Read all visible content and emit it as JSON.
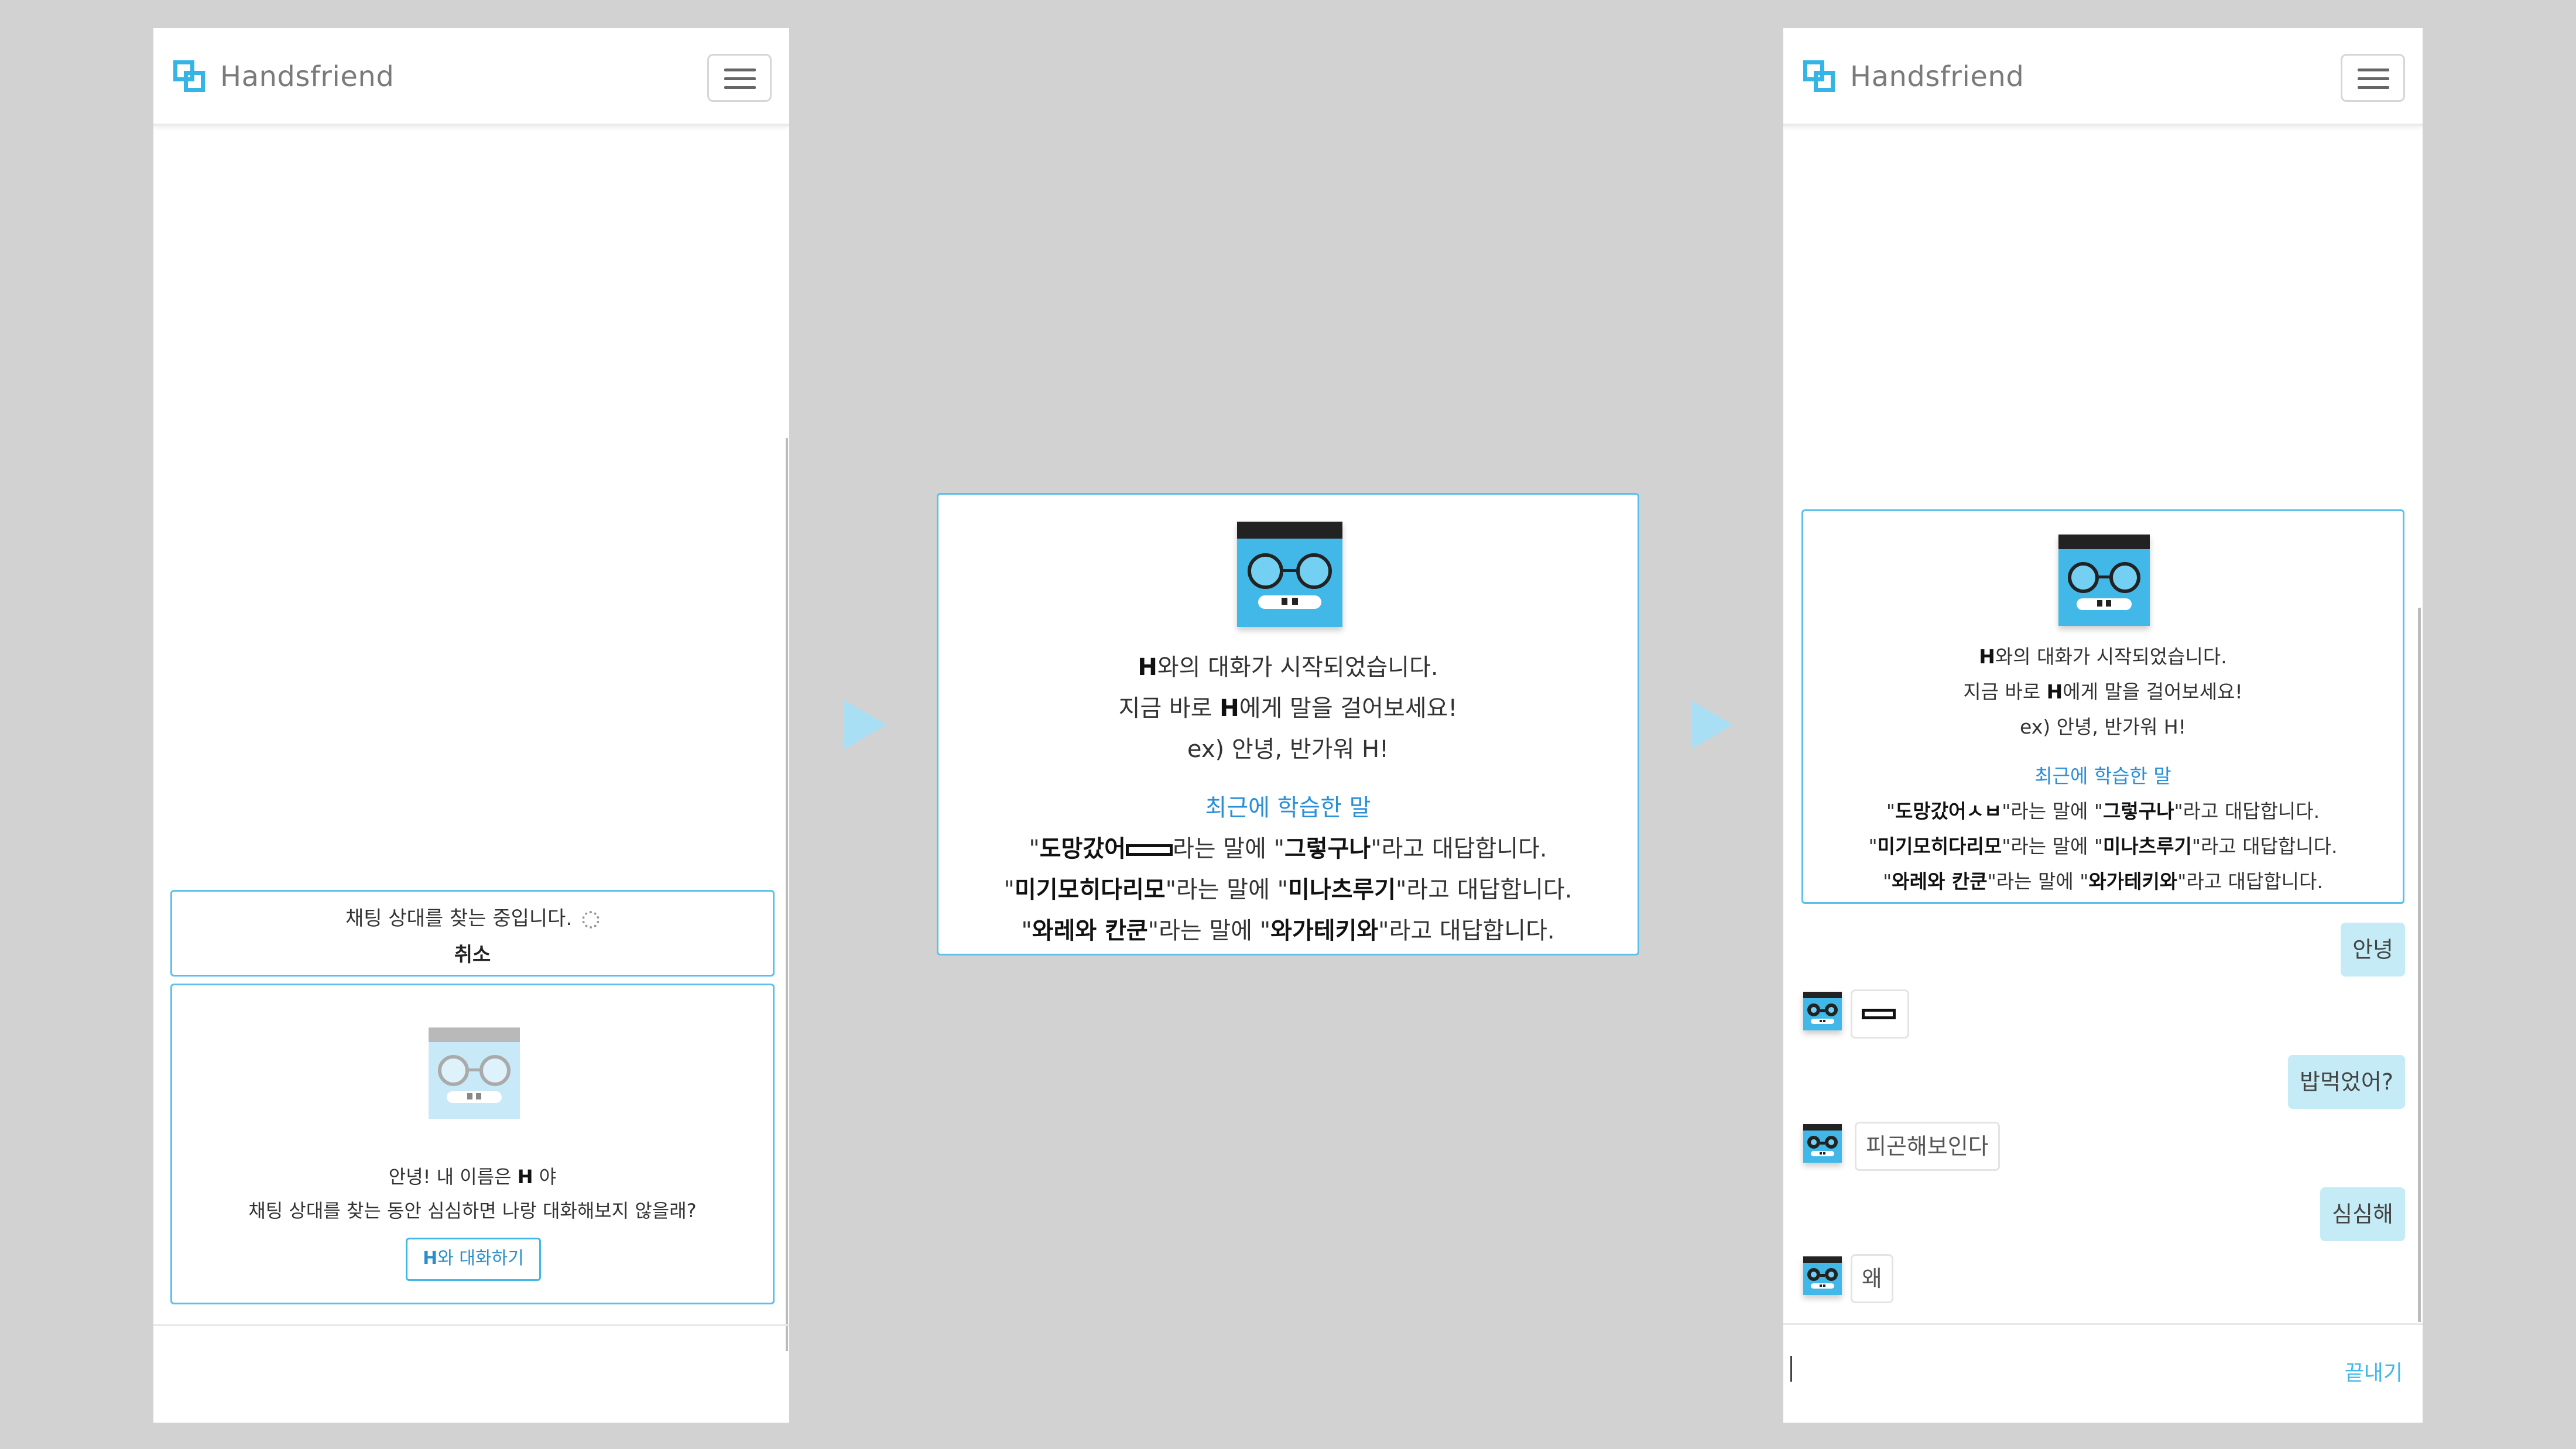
{
  "app": {
    "brand": "Handsfriend",
    "menu_icon": "hamburger-icon",
    "accent": "#35b5e5"
  },
  "panel1": {
    "searching": {
      "text": "채팅 상대를 찾는 중입니다.",
      "cancel": "취소"
    },
    "bot_invite": {
      "line1_pre": "안녕! 내 이름은 ",
      "line1_name": "H",
      "line1_post": " 야",
      "line2": "채팅 상대를 찾는 동안 심심하면 나랑 대화해보지 않을래?",
      "button_name": "H",
      "button_rest": "와 대화하기"
    }
  },
  "intro": {
    "start_name": "H",
    "start_rest": "와의 대화가 시작되었습니다.",
    "talk_pre": "지금 바로 ",
    "talk_name": "H",
    "talk_post": "에게 말을 걸어보세요!",
    "example": "ex) 안녕, 반가워 H!",
    "recent_title": "최근에 학습한 말",
    "learned_mid": "라는 말에 ",
    "learned_end": "라고 대답합니다.",
    "learned": [
      {
        "q": "도망갔어",
        "a": "그렇구나"
      },
      {
        "q": "미기모히다리모",
        "a": "미나츠루기"
      },
      {
        "q": "와레와 칸쿤",
        "a": "와가테키와"
      }
    ],
    "learned_q1_panel3": "도망갔어ㅅㅂ"
  },
  "chat": {
    "messages": [
      {
        "from": "me",
        "text": "안녕"
      },
      {
        "from": "H",
        "text": ""
      },
      {
        "from": "me",
        "text": "밥먹었어?"
      },
      {
        "from": "H",
        "text": "피곤해보인다"
      },
      {
        "from": "me",
        "text": "심심해"
      },
      {
        "from": "H",
        "text": "왜"
      }
    ],
    "input_value": "",
    "end_label": "끝내기"
  }
}
